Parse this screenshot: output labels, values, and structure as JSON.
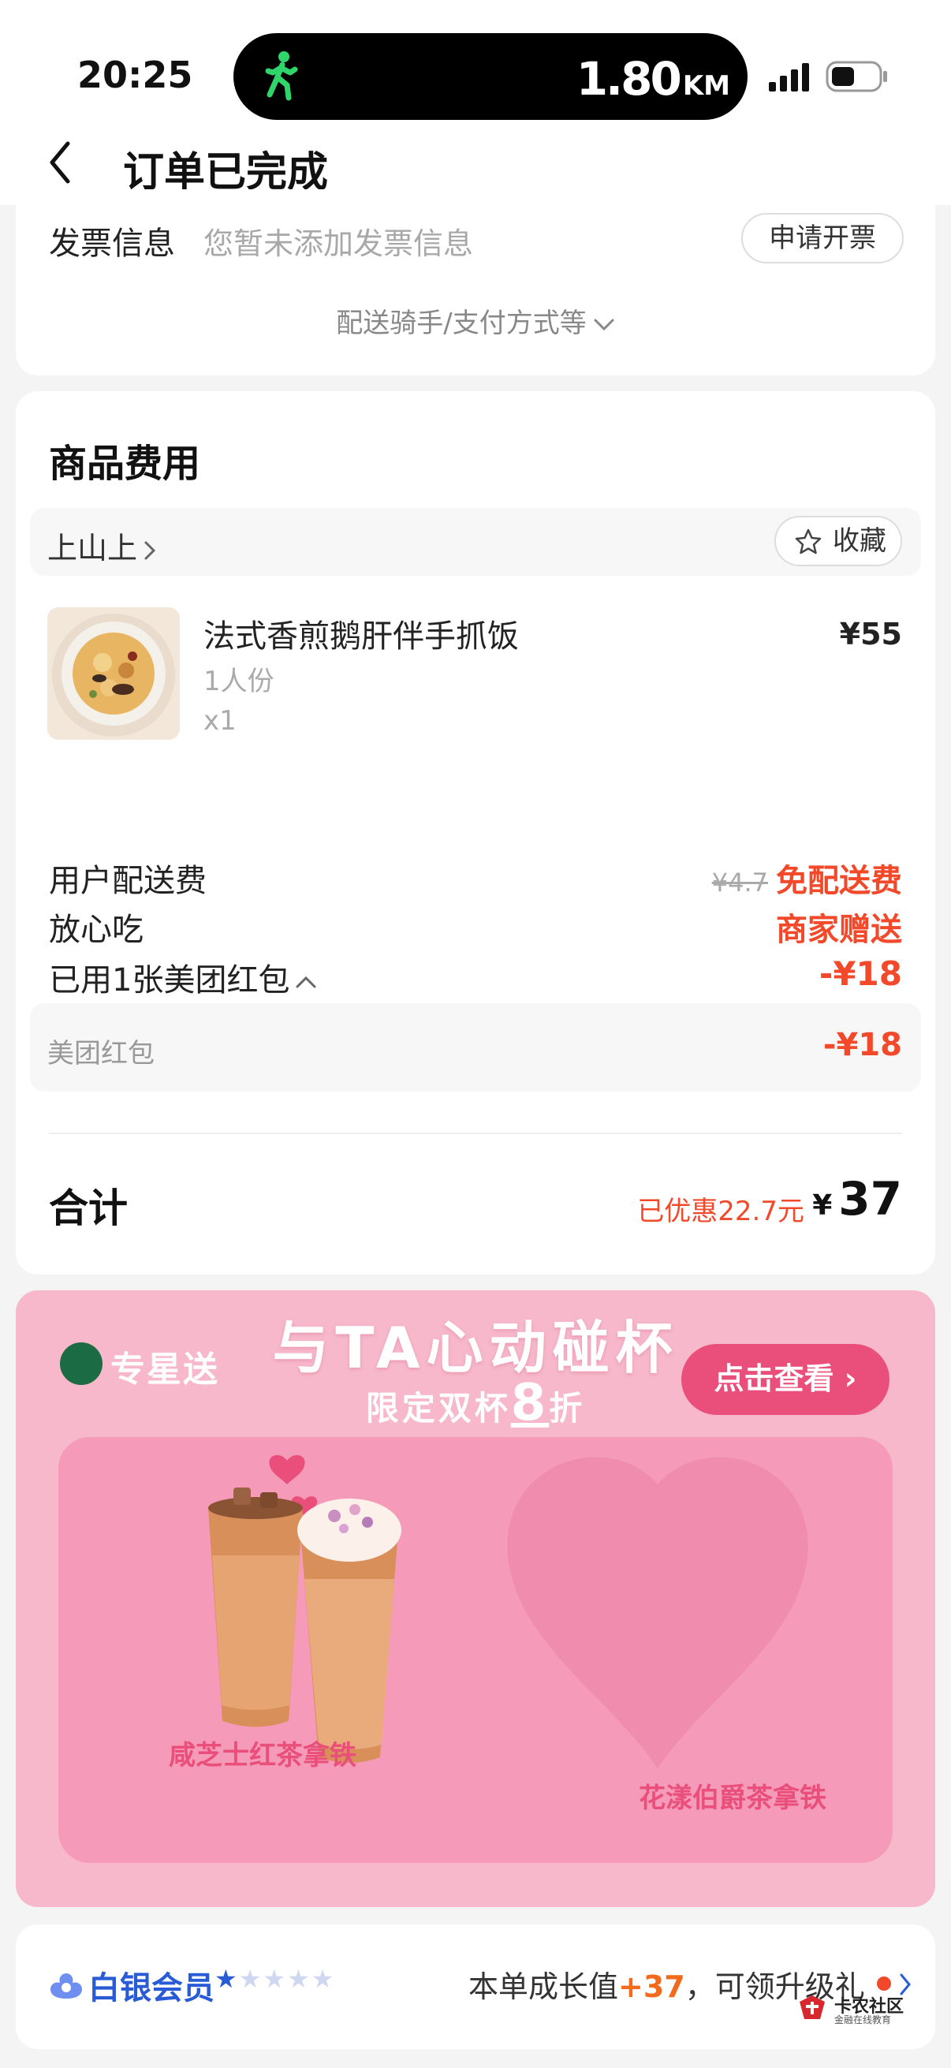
{
  "status_bar": {
    "time": "20:25",
    "activity_distance": "1.80",
    "activity_unit": "KM",
    "icons": [
      "walking-person-icon",
      "signal-icon",
      "battery-icon"
    ]
  },
  "header": {
    "back_icon": "chevron-left-icon",
    "title": "订单已完成"
  },
  "invoice": {
    "label": "发票信息",
    "value": "您暂未添加发票信息",
    "button": "申请开票",
    "more_toggle": "配送骑手/支付方式等"
  },
  "fees": {
    "title": "商品费用",
    "shop_name": "上山上",
    "favorite_button": "收藏",
    "item": {
      "name": "法式香煎鹅肝伴手抓饭",
      "portion": "1人份",
      "quantity": "x1",
      "price": "¥55"
    },
    "delivery": {
      "label": "用户配送费",
      "original": "¥4.7",
      "value": "免配送费"
    },
    "assurance": {
      "label": "放心吃",
      "value": "商家赠送"
    },
    "coupon": {
      "label": "已用1张美团红包",
      "value": "-¥18"
    },
    "coupon_detail": {
      "label": "美团红包",
      "value": "-¥18"
    },
    "total": {
      "label": "合计",
      "saved": "已优惠22.7元",
      "currency": "¥",
      "amount": "37"
    }
  },
  "banner": {
    "brand": "专星送",
    "headline": "与TA心动碰杯",
    "sub_prefix": "限定双杯",
    "sub_highlight": "8",
    "sub_suffix": "折",
    "cta": "点击查看",
    "drink1": "咸芝士红茶拿铁",
    "drink2": "花漾伯爵茶拿铁",
    "colors": {
      "background": "#f7b8cc",
      "cta": "#e94f7a"
    }
  },
  "member": {
    "level": "白银会员",
    "stars_filled": 1,
    "stars_total": 5,
    "growth_prefix": "本单成长值",
    "growth_value": "+37",
    "growth_suffix": "，可领升级礼",
    "watermark": "卡农社区",
    "watermark_sub": "金融在线教育"
  },
  "colors": {
    "accent_red": "#f2492b",
    "member_blue": "#2a5bd7",
    "growth_orange": "#f26b1d"
  }
}
